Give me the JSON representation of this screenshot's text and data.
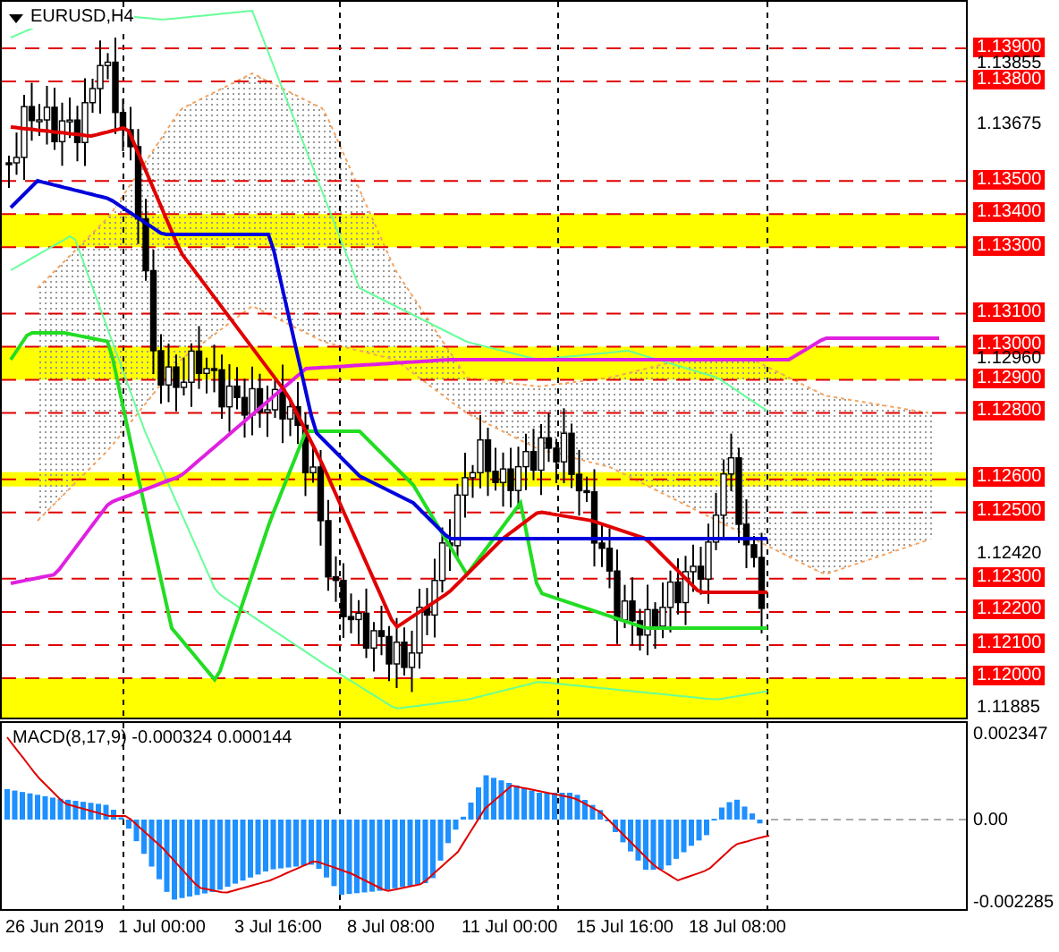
{
  "chart_title": "EURUSD,H4",
  "price_levels": [
    {
      "label": "1.13900"
    },
    {
      "label": "1.13800"
    },
    {
      "label": "1.13500"
    },
    {
      "label": "1.13400"
    },
    {
      "label": "1.13300"
    },
    {
      "label": "1.13100"
    },
    {
      "label": "1.13000"
    },
    {
      "label": "1.12900"
    },
    {
      "label": "1.12800"
    },
    {
      "label": "1.12600"
    },
    {
      "label": "1.12500"
    },
    {
      "label": "1.12300"
    },
    {
      "label": "1.12200"
    },
    {
      "label": "1.12100"
    },
    {
      "label": "1.12000"
    }
  ],
  "price_ticks": [
    "1.13855",
    "1.13675",
    "1.12960",
    "1.12420",
    "1.11885"
  ],
  "macd": {
    "label": "MACD(8,17,9) -0.000324 0.000144",
    "axis_labels": [
      "0.002347",
      "0.00",
      "-0.002285"
    ]
  },
  "time_labels": [
    "26 Jun 2019",
    "1 Jul 00:00",
    "3 Jul 16:00",
    "8 Jul 08:00",
    "11 Jul 00:00",
    "15 Jul 16:00",
    "18 Jul 08:00"
  ]
}
